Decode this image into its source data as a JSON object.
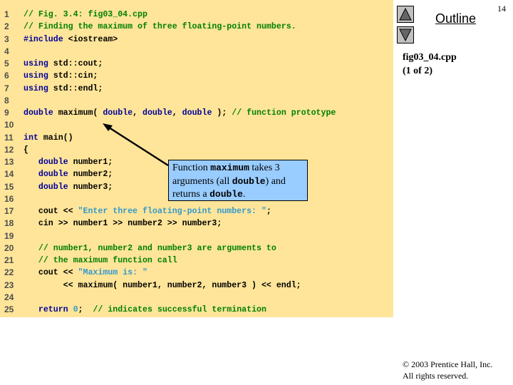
{
  "code_listing": {
    "lines": [
      {
        "n": "1",
        "segments": [
          {
            "t": "// Fig. 3.4: fig03_04.cpp",
            "c": "cm"
          }
        ]
      },
      {
        "n": "2",
        "segments": [
          {
            "t": "// Finding the maximum of three floating-point numbers.",
            "c": "cm"
          }
        ]
      },
      {
        "n": "3",
        "segments": [
          {
            "t": "#include",
            "c": "kw"
          },
          {
            "t": " <iostream>",
            "c": "tx"
          }
        ]
      },
      {
        "n": "4",
        "segments": []
      },
      {
        "n": "5",
        "segments": [
          {
            "t": "using",
            "c": "kw"
          },
          {
            "t": " std::cout;",
            "c": "tx"
          }
        ]
      },
      {
        "n": "6",
        "segments": [
          {
            "t": "using",
            "c": "kw"
          },
          {
            "t": " std::cin;",
            "c": "tx"
          }
        ]
      },
      {
        "n": "7",
        "segments": [
          {
            "t": "using",
            "c": "kw"
          },
          {
            "t": " std::endl;",
            "c": "tx"
          }
        ]
      },
      {
        "n": "8",
        "segments": []
      },
      {
        "n": "9",
        "segments": [
          {
            "t": "double",
            "c": "kw"
          },
          {
            "t": " maximum( ",
            "c": "tx"
          },
          {
            "t": "double",
            "c": "kw"
          },
          {
            "t": ", ",
            "c": "tx"
          },
          {
            "t": "double",
            "c": "kw"
          },
          {
            "t": ", ",
            "c": "tx"
          },
          {
            "t": "double",
            "c": "kw"
          },
          {
            "t": " ); ",
            "c": "tx"
          },
          {
            "t": "// function prototype",
            "c": "cm"
          }
        ]
      },
      {
        "n": "10",
        "segments": []
      },
      {
        "n": "11",
        "segments": [
          {
            "t": "int",
            "c": "kw"
          },
          {
            "t": " main()",
            "c": "tx"
          }
        ]
      },
      {
        "n": "12",
        "segments": [
          {
            "t": "{",
            "c": "tx"
          }
        ]
      },
      {
        "n": "13",
        "segments": [
          {
            "t": "   ",
            "c": "tx"
          },
          {
            "t": "double",
            "c": "kw"
          },
          {
            "t": " number1;",
            "c": "tx"
          }
        ]
      },
      {
        "n": "14",
        "segments": [
          {
            "t": "   ",
            "c": "tx"
          },
          {
            "t": "double",
            "c": "kw"
          },
          {
            "t": " number2;",
            "c": "tx"
          }
        ]
      },
      {
        "n": "15",
        "segments": [
          {
            "t": "   ",
            "c": "tx"
          },
          {
            "t": "double",
            "c": "kw"
          },
          {
            "t": " number3;",
            "c": "tx"
          }
        ]
      },
      {
        "n": "16",
        "segments": []
      },
      {
        "n": "17",
        "segments": [
          {
            "t": "   cout << ",
            "c": "tx"
          },
          {
            "t": "\"Enter three floating-point numbers: \"",
            "c": "st"
          },
          {
            "t": ";",
            "c": "tx"
          }
        ]
      },
      {
        "n": "18",
        "segments": [
          {
            "t": "   cin >> number1 >> number2 >> number3;",
            "c": "tx"
          }
        ]
      },
      {
        "n": "19",
        "segments": []
      },
      {
        "n": "20",
        "segments": [
          {
            "t": "   ",
            "c": "tx"
          },
          {
            "t": "// number1, number2 and number3 are arguments to",
            "c": "cm"
          }
        ]
      },
      {
        "n": "21",
        "segments": [
          {
            "t": "   ",
            "c": "tx"
          },
          {
            "t": "// the maximum function call",
            "c": "cm"
          }
        ]
      },
      {
        "n": "22",
        "segments": [
          {
            "t": "   cout << ",
            "c": "tx"
          },
          {
            "t": "\"Maximum is: \"",
            "c": "st"
          }
        ]
      },
      {
        "n": "23",
        "segments": [
          {
            "t": "        << maximum( number1, number2, number3 ) << endl;",
            "c": "tx"
          }
        ]
      },
      {
        "n": "24",
        "segments": []
      },
      {
        "n": "25",
        "segments": [
          {
            "t": "   ",
            "c": "tx"
          },
          {
            "t": "return",
            "c": "kw"
          },
          {
            "t": " ",
            "c": "tx"
          },
          {
            "t": "0",
            "c": "nm"
          },
          {
            "t": ";  ",
            "c": "tx"
          },
          {
            "t": "// indicates successful termination",
            "c": "cm"
          }
        ]
      }
    ]
  },
  "callout": {
    "part1": "Function ",
    "code1": "maximum",
    "part2": " takes 3 arguments (all ",
    "code2": "double",
    "part3": ") and returns a ",
    "code3": "double",
    "part4": "."
  },
  "navigation": {
    "up_icon": "triangle-up-icon",
    "down_icon": "triangle-down-icon",
    "outline_label": "Outline"
  },
  "page_number": "14",
  "file_info": {
    "filename": "fig03_04.cpp",
    "part": "(1 of 2)"
  },
  "copyright": {
    "line1": "© 2003 Prentice Hall, Inc.",
    "line2": "All rights reserved."
  },
  "colors": {
    "panel_bg": "#ffe599",
    "keyword": "#000099",
    "comment": "#008000",
    "string": "#3399cc",
    "callout_bg": "#99ccff"
  }
}
